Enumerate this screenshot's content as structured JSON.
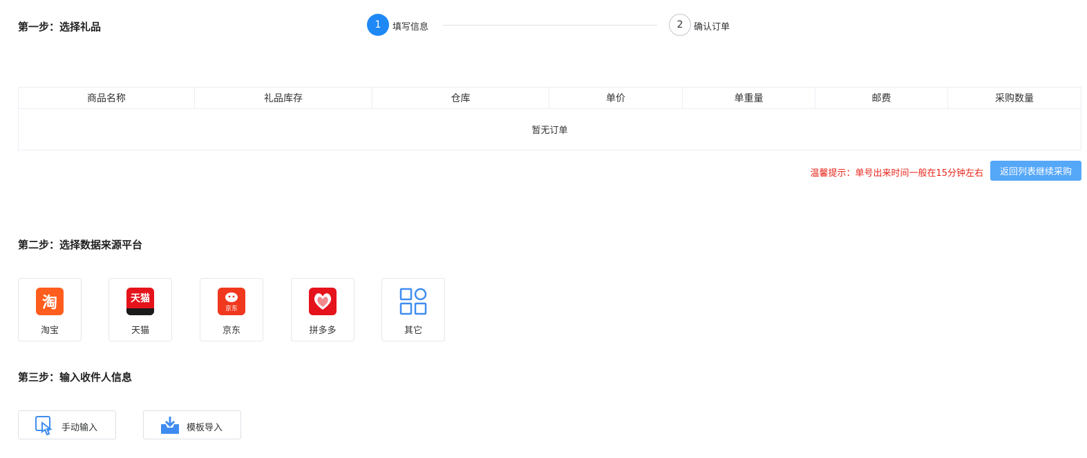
{
  "step1": {
    "title": "第一步：选择礼品"
  },
  "steps": [
    {
      "number": "1",
      "label": "填写信息"
    },
    {
      "number": "2",
      "label": "确认订单"
    }
  ],
  "table": {
    "columns": [
      "商品名称",
      "礼品库存",
      "仓库",
      "单价",
      "单重量",
      "邮费",
      "采购数量"
    ],
    "empty_text": "暂无订单"
  },
  "tip": "温馨提示：单号出来时间一般在15分钟左右",
  "back_button": "返回列表继续采购",
  "step2": {
    "title": "第二步：选择数据来源平台"
  },
  "platforms": [
    {
      "name": "淘宝",
      "icon": "taobao-icon",
      "logo_text": "淘",
      "color": "#ff5d1d"
    },
    {
      "name": "天猫",
      "icon": "tmall-icon",
      "logo_text": "天猫",
      "color": "#e5131c"
    },
    {
      "name": "京东",
      "icon": "jd-icon",
      "logo_text": "京东",
      "color": "#f0381f"
    },
    {
      "name": "拼多多",
      "icon": "pinduoduo-icon",
      "color": "#e5131c"
    },
    {
      "name": "其它",
      "icon": "grid-icon",
      "color": "#3f8cf0"
    }
  ],
  "step3": {
    "title": "第三步：输入收件人信息"
  },
  "entry": {
    "manual_label": "手动输入",
    "template_label": "模板导入"
  },
  "colors": {
    "accent": "#1e88f5",
    "button": "#55a7f8",
    "warning": "#e8261c"
  }
}
